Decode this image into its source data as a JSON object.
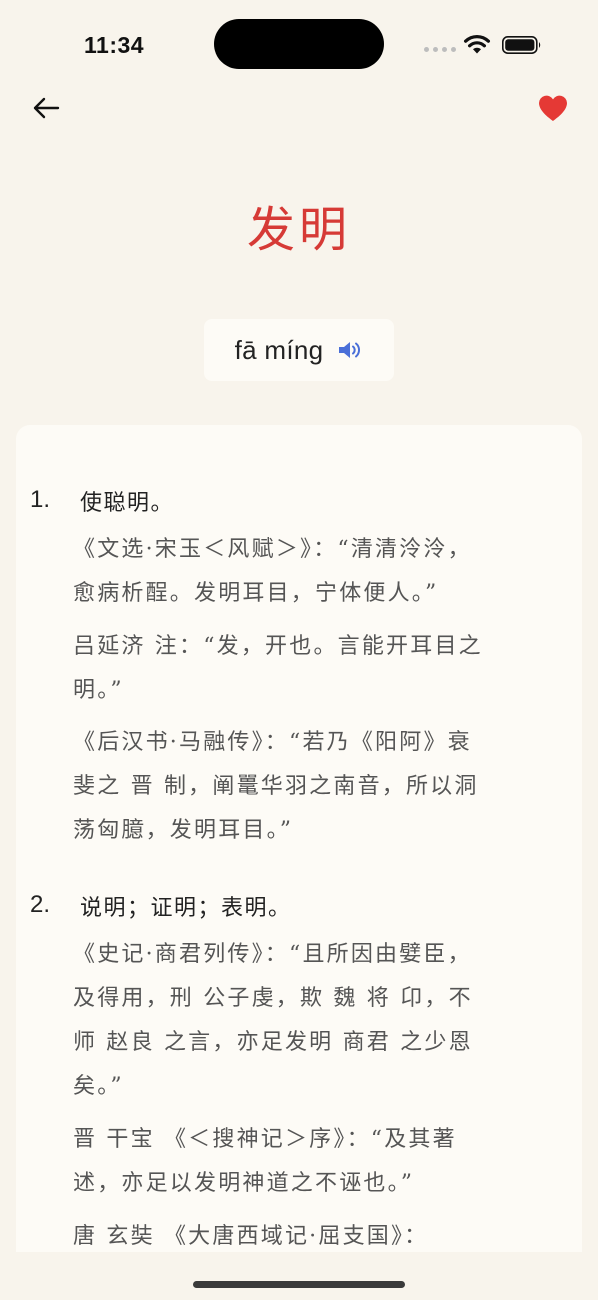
{
  "status_bar": {
    "time": "11:34"
  },
  "header": {
    "back_icon": "arrow-left-icon",
    "favorite_icon": "heart-icon",
    "favorite_color": "#e53935"
  },
  "entry": {
    "word": "发明",
    "word_color": "#d63a36",
    "pinyin": "fā míng",
    "audio_icon": "speaker-icon",
    "audio_color": "#4a6fd8"
  },
  "senses": [
    {
      "number": "1.",
      "definition": "使聪明。",
      "quotes": [
        [
          "《文选·宋玉＜风赋＞》：“清清泠泠，",
          "愈病析酲。发明耳目，宁体便人。”"
        ],
        [
          "吕延济 注：“发，开也。言能开耳目之",
          "明。”"
        ],
        [
          "《后汉书·马融传》：“若乃《阳阿》衰",
          "斐之 晋 制，阐鼍华羽之南音，所以洞",
          "荡匈臆，发明耳目。”"
        ]
      ]
    },
    {
      "number": "2.",
      "definition": "说明；证明；表明。",
      "quotes": [
        [
          "《史记·商君列传》：“且所因由嬖臣，",
          "及得用，刑 公子虔，欺 魏 将 卬，不",
          "师 赵良 之言，亦足发明 商君 之少恩",
          "矣。”"
        ],
        [
          "晋 干宝 《＜搜神记＞序》：“及其著",
          "述，亦足以发明神道之不诬也。”"
        ],
        [
          "唐 玄奘 《大唐西域记·屈支国》："
        ]
      ]
    }
  ]
}
